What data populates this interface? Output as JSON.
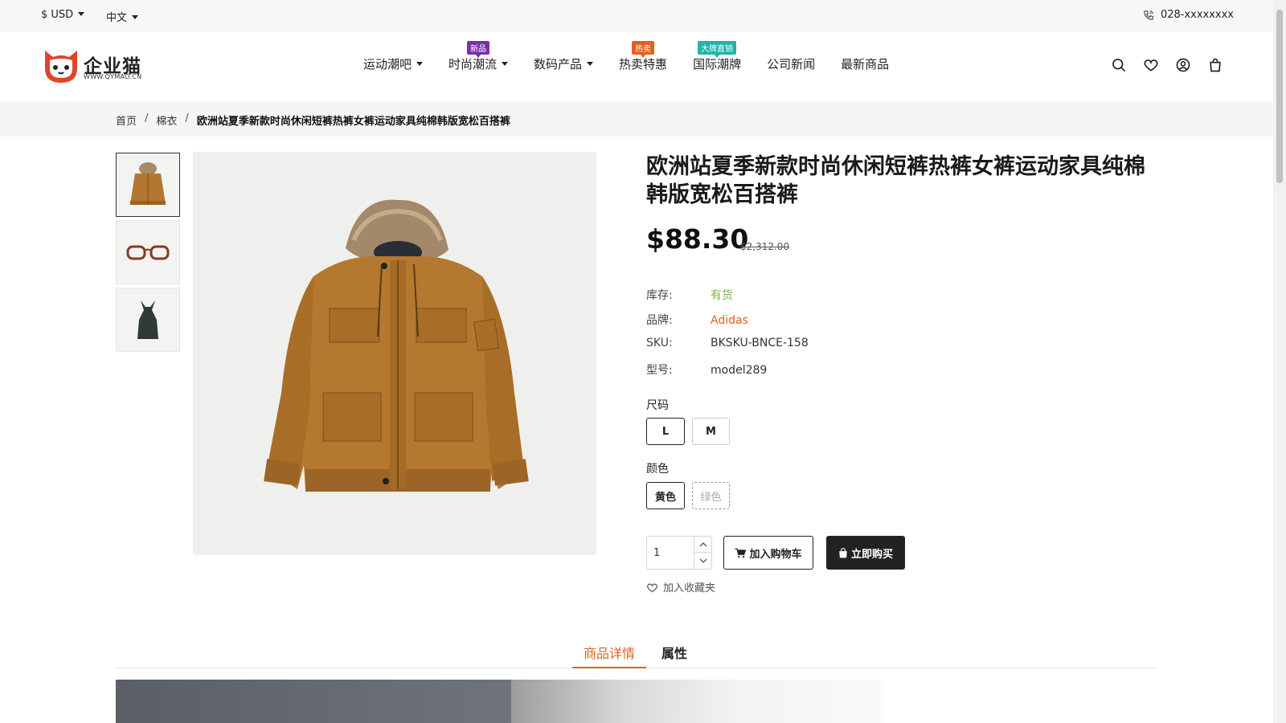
{
  "topbar": {
    "currency": "$ USD",
    "language": "中文",
    "phone": "028-xxxxxxxx"
  },
  "logo": {
    "name": "企业猫",
    "url_text": "WWW.QYMAO.CN"
  },
  "nav": {
    "items": [
      {
        "label": "运动潮吧",
        "dropdown": true,
        "badge": ""
      },
      {
        "label": "时尚潮流",
        "dropdown": true,
        "badge": "新品",
        "badge_color": "#7b2fa8"
      },
      {
        "label": "数码产品",
        "dropdown": true,
        "badge": ""
      },
      {
        "label": "热卖特惠",
        "dropdown": false,
        "badge": "热卖",
        "badge_color": "#e0601f"
      },
      {
        "label": "国际潮牌",
        "dropdown": false,
        "badge": "大牌直销",
        "badge_color": "#1fb5a8"
      },
      {
        "label": "公司新闻",
        "dropdown": false,
        "badge": ""
      },
      {
        "label": "最新商品",
        "dropdown": false,
        "badge": ""
      }
    ],
    "icons": [
      "search-icon",
      "heart-icon",
      "user-icon",
      "bag-icon"
    ]
  },
  "breadcrumb": {
    "home": "首页",
    "category": "棉衣",
    "current": "欧洲站夏季新款时尚休闲短裤热裤女裤运动家具纯棉韩版宽松百搭裤"
  },
  "product": {
    "title": "欧洲站夏季新款时尚休闲短裤热裤女裤运动家具纯棉韩版宽松百搭裤",
    "price": "$88.30",
    "old_price": "$2,312.00",
    "stock_label": "库存:",
    "stock_value": "有货",
    "brand_label": "品牌:",
    "brand_value": "Adidas",
    "sku_label": "SKU:",
    "sku_value": "BKSKU-BNCE-158",
    "model_label": "型号:",
    "model_value": "model289",
    "size_label": "尺码",
    "sizes": [
      "L",
      "M"
    ],
    "selected_size": "L",
    "color_label": "颜色",
    "colors": [
      "黄色",
      "绿色"
    ],
    "selected_color": "黄色",
    "quantity": "1",
    "add_to_cart": "加入购物车",
    "buy_now": "立即购买",
    "add_to_favorites": "加入收藏夹",
    "accent_color": "#e0601f",
    "stock_color": "#7cb342"
  },
  "tabs": {
    "details": "商品详情",
    "attributes": "属性"
  }
}
